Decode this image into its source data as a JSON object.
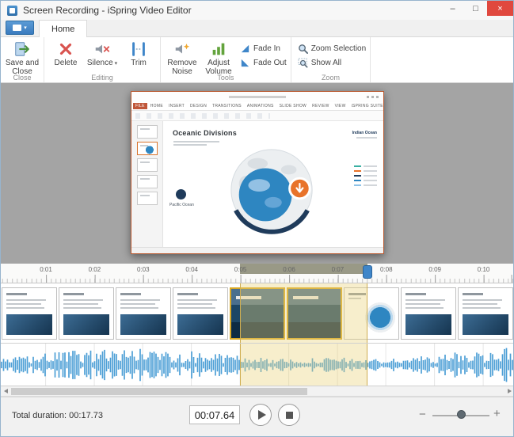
{
  "window": {
    "title": "Screen Recording - iSpring Video Editor",
    "controls": {
      "minimize": "–",
      "maximize": "□",
      "close": "×"
    }
  },
  "ribbon": {
    "home_tab": "Home",
    "close_group": {
      "label": "Close",
      "save_and_close": "Save and Close"
    },
    "editing_group": {
      "label": "Editing",
      "delete": "Delete",
      "silence": "Silence",
      "trim": "Trim"
    },
    "tools_group": {
      "label": "Tools",
      "remove_noise": "Remove Noise",
      "adjust_volume": "Adjust Volume",
      "fade_in": "Fade In",
      "fade_out": "Fade Out"
    },
    "zoom_group": {
      "label": "Zoom",
      "zoom_selection": "Zoom Selection",
      "show_all": "Show All"
    }
  },
  "preview": {
    "ppt_tabs": [
      "FILE",
      "HOME",
      "INSERT",
      "DESIGN",
      "TRANSITIONS",
      "ANIMATIONS",
      "SLIDE SHOW",
      "REVIEW",
      "VIEW",
      "iSPRING SUITE 8"
    ],
    "slide_title": "Oceanic Divisions",
    "indian_ocean_label": "Indian Ocean",
    "pacific_ocean_label": "Pacific Ocean",
    "legend_colors": [
      "#3ab0a2",
      "#e8732a",
      "#1f3b5b",
      "#2e86c1",
      "#8fc3e8"
    ],
    "sidebar_thumb_count": 5,
    "active_sidebar_thumb": 1
  },
  "timeline": {
    "ticks": [
      "0:01",
      "0:02",
      "0:03",
      "0:04",
      "0:05",
      "0:06",
      "0:07",
      "0:08",
      "0:09",
      "0:10"
    ],
    "video_thumbnails": [
      {
        "type": "doc",
        "selected": false
      },
      {
        "type": "doc",
        "selected": false
      },
      {
        "type": "doc",
        "selected": false
      },
      {
        "type": "doc",
        "selected": false
      },
      {
        "type": "photo",
        "selected": true
      },
      {
        "type": "photo",
        "selected": true
      },
      {
        "type": "globe",
        "selected": false
      },
      {
        "type": "doc",
        "selected": false
      },
      {
        "type": "doc",
        "selected": false
      }
    ]
  },
  "footer": {
    "total_duration": "Total duration: 00:17.73",
    "current_time": "00:07.64",
    "zoom_out": "−",
    "zoom_in": "+"
  },
  "colors": {
    "accent_blue": "#3f86c9",
    "selection_yellow": "#e9d382",
    "ruler_selection_band": "#8e8e79",
    "waveform_blue": "#4d9fd6",
    "close_button_red": "#e0483e",
    "ppt_file_tab_orange": "#c0573a"
  }
}
